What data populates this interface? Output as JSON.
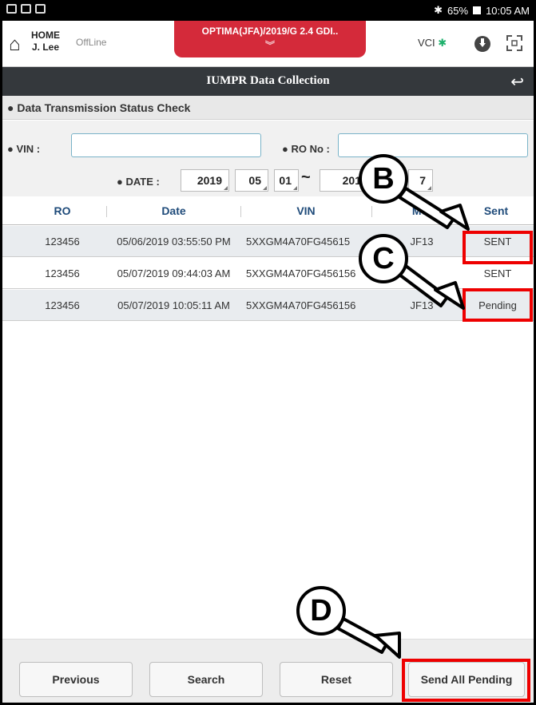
{
  "status_bar": {
    "bluetooth": "✱",
    "battery": "65%",
    "time": "10:05 AM"
  },
  "header": {
    "home_label": "HOME",
    "user": "J. Lee",
    "mode": "OffLine",
    "vehicle": "OPTIMA(JFA)/2019/G 2.4 GDI..",
    "vci_label": "VCI",
    "bt_glyph": "✱"
  },
  "titlebar": {
    "title": "IUMPR Data Collection"
  },
  "section": {
    "title": "Data Transmission Status Check"
  },
  "filters": {
    "vin_label": "VIN :",
    "vin_value": "",
    "ro_label": "RO No :",
    "ro_value": "",
    "date_label": "DATE :",
    "date_from": {
      "year": "2019",
      "month": "05",
      "day": "01"
    },
    "date_to": {
      "year": "201",
      "day": "7"
    },
    "range_sep": "~"
  },
  "table": {
    "columns": [
      "RO",
      "Date",
      "VIN",
      "Mo",
      "Sent"
    ],
    "rows": [
      {
        "ro": "123456",
        "date": "05/06/2019 03:55:50 PM",
        "vin": "5XXGM4A70FG45615",
        "model": "JF13",
        "sent": "SENT"
      },
      {
        "ro": "123456",
        "date": "05/07/2019 09:44:03 AM",
        "vin": "5XXGM4A70FG456156",
        "model": "",
        "sent": "SENT"
      },
      {
        "ro": "123456",
        "date": "05/07/2019 10:05:11 AM",
        "vin": "5XXGM4A70FG456156",
        "model": "JF13",
        "sent": "Pending"
      }
    ]
  },
  "footer": {
    "previous": "Previous",
    "search": "Search",
    "reset": "Reset",
    "send_all_pending": "Send All Pending"
  },
  "callouts": {
    "b": "B",
    "c": "C",
    "d": "D"
  },
  "colors": {
    "accent_red": "#d42a3a",
    "highlight_red": "#e00000",
    "titlebar": "#34383c",
    "header_text": "#1f4b7a"
  }
}
